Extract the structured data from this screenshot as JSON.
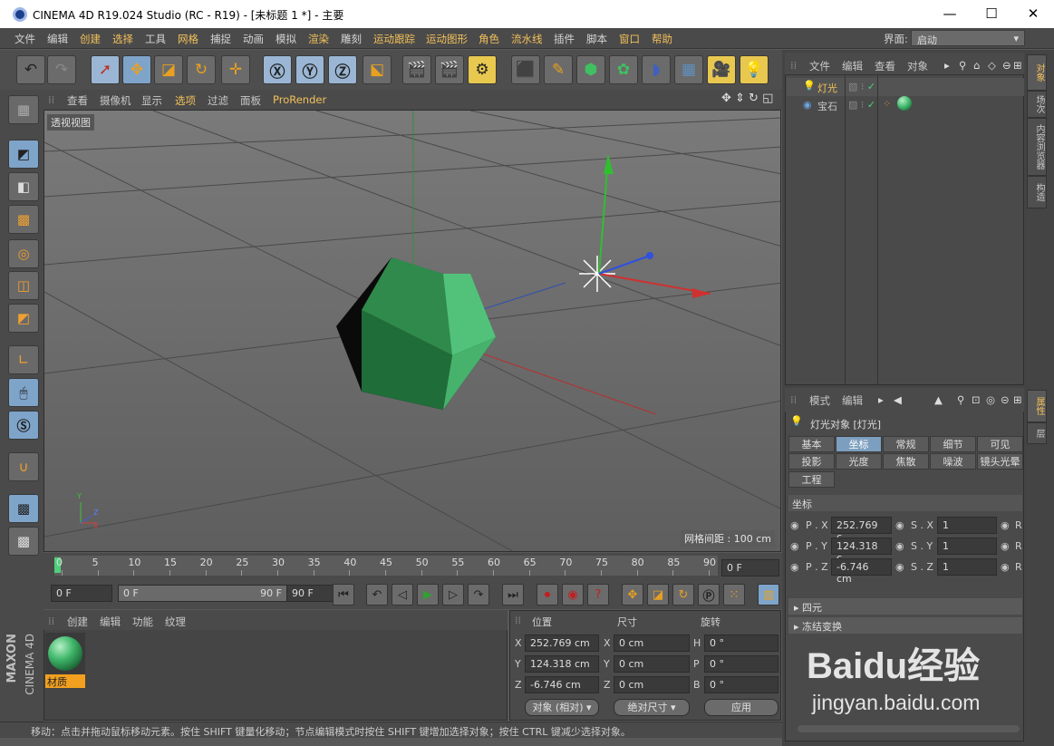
{
  "window": {
    "title": "CINEMA 4D R19.024 Studio (RC - R19) - [未标题 1 *] - 主要",
    "minimize": "—",
    "maximize": "☐",
    "close": "✕"
  },
  "menu": [
    "文件",
    "编辑",
    "创建",
    "选择",
    "工具",
    "网格",
    "捕捉",
    "动画",
    "模拟",
    "渲染",
    "雕刻",
    "运动跟踪",
    "运动图形",
    "角色",
    "流水线",
    "插件",
    "脚本",
    "窗口",
    "帮助"
  ],
  "layout": {
    "label": "界面:",
    "value": "启动"
  },
  "viewport": {
    "menu": [
      "查看",
      "摄像机",
      "显示",
      "选项",
      "过滤",
      "面板",
      "ProRender"
    ],
    "name": "透视视图",
    "grid_info": "网格间距 : 100 cm"
  },
  "timeline": {
    "ticks": [
      "0",
      "5",
      "10",
      "15",
      "20",
      "25",
      "30",
      "35",
      "40",
      "45",
      "50",
      "55",
      "60",
      "65",
      "70",
      "75",
      "80",
      "85",
      "90"
    ],
    "current_frame": "0 F"
  },
  "fields": {
    "start": "0 F",
    "range_start": "0 F",
    "range_end": "90 F",
    "end": "90 F"
  },
  "material": {
    "menu": [
      "创建",
      "编辑",
      "功能",
      "纹理"
    ],
    "item_label": "材质"
  },
  "coords": {
    "headers": [
      "位置",
      "尺寸",
      "旋转"
    ],
    "rows": [
      {
        "axis": "X",
        "pos": "252.769 cm",
        "size_axis": "X",
        "size": "0 cm",
        "rot_axis": "H",
        "rot": "0 °"
      },
      {
        "axis": "Y",
        "pos": "124.318 cm",
        "size_axis": "Y",
        "size": "0 cm",
        "rot_axis": "P",
        "rot": "0 °"
      },
      {
        "axis": "Z",
        "pos": "-6.746 cm",
        "size_axis": "Z",
        "size": "0 cm",
        "rot_axis": "B",
        "rot": "0 °"
      }
    ],
    "mode": "对象 (相对)",
    "size_mode": "绝对尺寸",
    "apply": "应用"
  },
  "status": "移动：点击并拖动鼠标移动元素。按住 SHIFT 键量化移动；节点编辑模式时按住 SHIFT 键增加选择对象；按住 CTRL 键减少选择对象。",
  "objects": {
    "menu": [
      "文件",
      "编辑",
      "查看",
      "对象"
    ],
    "items": [
      {
        "name": "灯光"
      },
      {
        "name": "宝石"
      }
    ]
  },
  "attributes": {
    "menu": [
      "模式",
      "编辑"
    ],
    "title": "灯光对象 [灯光]",
    "tabs": [
      [
        "基本",
        "坐标",
        "常规",
        "细节",
        "可见"
      ],
      [
        "投影",
        "光度",
        "焦散",
        "噪波",
        "镜头光晕"
      ],
      [
        "工程"
      ]
    ],
    "section": "坐标",
    "rows": [
      {
        "p": "P . X",
        "pv": "252.769 c",
        "s": "S . X",
        "sv": "1",
        "r": "R"
      },
      {
        "p": "P . Y",
        "pv": "124.318 c",
        "s": "S . Y",
        "sv": "1",
        "r": "R"
      },
      {
        "p": "P . Z",
        "pv": "-6.746 cm",
        "s": "S . Z",
        "sv": "1",
        "r": "R"
      }
    ],
    "groups": [
      "四元",
      "冻结变换"
    ]
  },
  "side_tabs_top": [
    "对象",
    "场次",
    "内容浏览器",
    "构造"
  ],
  "side_tabs_bottom": [
    "属性",
    "层"
  ],
  "brand": {
    "maxon": "MAXON",
    "cinema": "CINEMA 4D"
  },
  "watermark": {
    "main": "Baidu经验",
    "sub": "jingyan.baidu.com"
  },
  "colors": {
    "accent": "#f2c05a",
    "selected_tab": "#7d9fbf",
    "gem": "#3fb66a"
  }
}
